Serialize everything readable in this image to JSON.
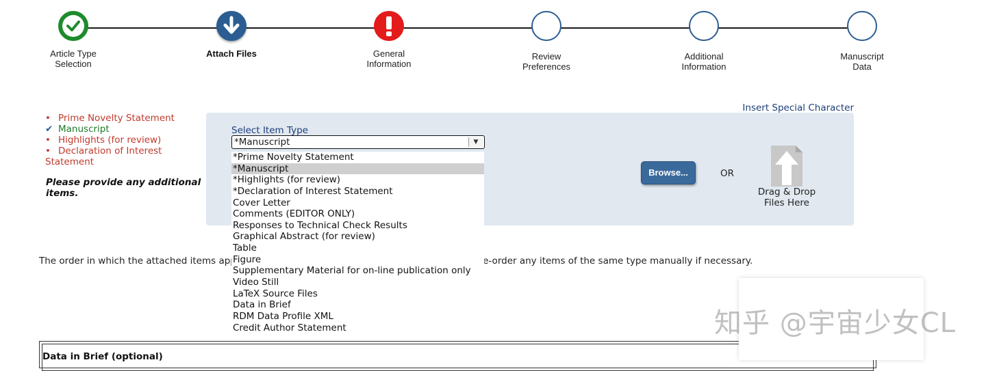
{
  "steps": [
    {
      "label_line1": "Article Type",
      "label_line2": "Selection",
      "state": "done",
      "icon": "checkmark-icon"
    },
    {
      "label_line1": "Attach Files",
      "label_line2": "",
      "state": "current",
      "icon": "down-arrow-icon"
    },
    {
      "label_line1": "General",
      "label_line2": "Information",
      "state": "error",
      "icon": "exclamation-icon"
    },
    {
      "label_line1": "Review",
      "label_line2": "Preferences",
      "state": "future",
      "icon": ""
    },
    {
      "label_line1": "Additional",
      "label_line2": "Information",
      "state": "future",
      "icon": ""
    },
    {
      "label_line1": "Manuscript",
      "label_line2": "Data",
      "state": "future",
      "icon": ""
    }
  ],
  "checklist": {
    "items": [
      {
        "label": "Prime Novelty Statement",
        "status": "missing",
        "mark": "•"
      },
      {
        "label": "Manuscript",
        "status": "ok",
        "mark": "✔"
      },
      {
        "label": "Highlights (for review)",
        "status": "missing",
        "mark": "•"
      },
      {
        "label": "Declaration of Interest",
        "label_line2": "Statement",
        "status": "missing",
        "mark": "•"
      }
    ],
    "prompt": "Please provide any additional items."
  },
  "insert_special_character": "Insert Special Character",
  "upload": {
    "select_label": "Select Item Type",
    "selected_value": "*Manuscript",
    "options": [
      "*Prime Novelty Statement",
      "*Manuscript",
      "*Highlights (for review)",
      "*Declaration of Interest Statement",
      "Cover Letter",
      "Comments (EDITOR ONLY)",
      "Responses to Technical Check Results",
      "Graphical Abstract (for review)",
      "Table",
      "Figure",
      "Supplementary Material for on-line publication only",
      "Video Still",
      "LaTeX Source Files",
      "Data in Brief",
      "RDM Data Profile XML",
      "Credit Author Statement"
    ],
    "highlighted_index": 1,
    "browse_label": "Browse...",
    "or_label": "OR",
    "drop_line1": "Drag & Drop",
    "drop_line2": "Files Here"
  },
  "order_note_start": "The order in which the attached items app",
  "order_note_end": "re-order any items of the same type manually if necessary.",
  "data_in_brief_title": "Data in Brief (optional)",
  "watermark": "知乎 @宇宙少女CL",
  "colors": {
    "done": "#1e8b2d",
    "current": "#2b5d92",
    "error": "#e31b1b",
    "missing_text": "#c0392b",
    "ok_text": "#1e7b2a",
    "panel_bg": "#e1e8f0",
    "browse_bg": "#3a6a9c"
  }
}
